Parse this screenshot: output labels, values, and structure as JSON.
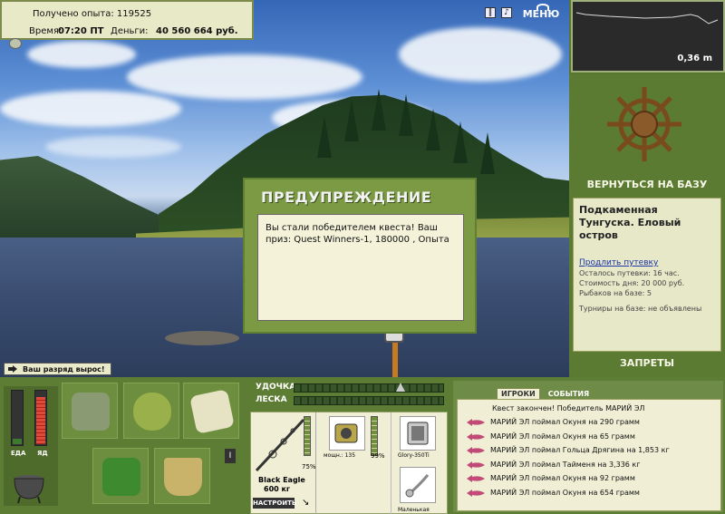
{
  "hud": {
    "experience_label": "Получено опыта: 119525",
    "time_label": "Время:",
    "time_value": "07:20 ПТ",
    "money_label": "Деньги:",
    "money_value": "40 560 664 руб.",
    "menu_label": "МЕНЮ"
  },
  "depth": {
    "value": "0,36 m"
  },
  "right_panel": {
    "return_label": "ВЕРНУТЬСЯ НА БАЗУ",
    "location": "Подкаменная Тунгуска. Еловый остров",
    "extend_link": "Продлить путевку",
    "trip_left": "Осталось путевки: 16 час.",
    "day_cost": "Стоимость дня: 20 000 руб.",
    "fishers": "Рыбаков на базе: 5",
    "tournaments": "Турниры на базе: не объявлены",
    "bans_label": "ЗАПРЕТЫ"
  },
  "dialog": {
    "title": "ПРЕДУПРЕЖДЕНИЕ",
    "message": "Вы стали победителем квеста! Ваш приз: Quest Winners-1, 180000 , Опыта"
  },
  "rank_message": "Ваш разряд вырос!",
  "needs": {
    "food_label": "ЕДА",
    "poison_label": "ЯД",
    "food_level": 0.1,
    "poison_level": 0.9
  },
  "tension": {
    "rod_label": "УДОЧКА",
    "line_label": "ЛЕСКА",
    "rod_level": 0.7
  },
  "tackle": {
    "rod_name": "Black Eagle",
    "rod_weight": "600 кг",
    "rod_pct": "75%",
    "setup_label": "НАСТРОИТЬ",
    "reel_power": "мощн.: 135",
    "reel_pct": "99%",
    "lure_name": "Glory-350Ti",
    "lure2_name": "Маленькая"
  },
  "events": {
    "tab_games": "ИГРОКИ",
    "tab_events": "СОБЫТИЯ",
    "header": "Квест закончен! Победитель МАРИЙ ЭЛ",
    "items": [
      "МАРИЙ ЭЛ поймал Окуня на 290 грамм",
      "МАРИЙ ЭЛ поймал Окуня на 65 грамм",
      "МАРИЙ ЭЛ поймал Гольца Дрягина на 1,853 кг",
      "МАРИЙ ЭЛ поймал Тайменя на 3,336 кг",
      "МАРИЙ ЭЛ поймал Окуня на 92 грамм",
      "МАРИЙ ЭЛ поймал Окуня на 654 грамм"
    ]
  },
  "colors": {
    "panel_green": "#5b7a32",
    "cream": "#f0efd6",
    "food_fill": "#3d7a30",
    "poison_fill": "#d03a2a"
  },
  "icons": [
    "pause-icon",
    "sound-icon",
    "ship-wheel-icon",
    "cooking-pot-icon",
    "tackle-box-icon",
    "bait-bag-icon",
    "map-icon",
    "food-basket-icon",
    "bucket-icon",
    "fish-icon"
  ]
}
